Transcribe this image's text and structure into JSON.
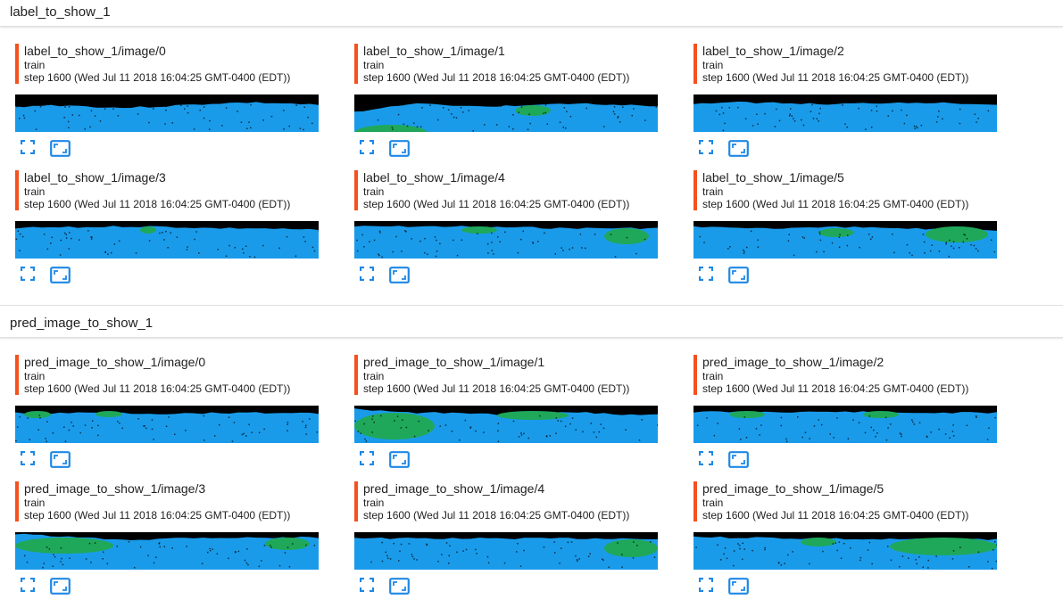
{
  "colors": {
    "accent": "#f4511e",
    "icon": "#1e88e5",
    "sky": "#000000",
    "ground": "#1a9bea",
    "veg": "#1fa85a"
  },
  "sections": [
    {
      "title": "label_to_show_1",
      "cards": [
        {
          "title": "label_to_show_1/image/0",
          "run": "train",
          "step": "step 1600 (Wed Jul 11 2018 16:04:25 GMT-0400 (EDT))"
        },
        {
          "title": "label_to_show_1/image/1",
          "run": "train",
          "step": "step 1600 (Wed Jul 11 2018 16:04:25 GMT-0400 (EDT))"
        },
        {
          "title": "label_to_show_1/image/2",
          "run": "train",
          "step": "step 1600 (Wed Jul 11 2018 16:04:25 GMT-0400 (EDT))"
        },
        {
          "title": "label_to_show_1/image/3",
          "run": "train",
          "step": "step 1600 (Wed Jul 11 2018 16:04:25 GMT-0400 (EDT))"
        },
        {
          "title": "label_to_show_1/image/4",
          "run": "train",
          "step": "step 1600 (Wed Jul 11 2018 16:04:25 GMT-0400 (EDT))"
        },
        {
          "title": "label_to_show_1/image/5",
          "run": "train",
          "step": "step 1600 (Wed Jul 11 2018 16:04:25 GMT-0400 (EDT))"
        }
      ]
    },
    {
      "title": "pred_image_to_show_1",
      "cards": [
        {
          "title": "pred_image_to_show_1/image/0",
          "run": "train",
          "step": "step 1600 (Wed Jul 11 2018 16:04:25 GMT-0400 (EDT))"
        },
        {
          "title": "pred_image_to_show_1/image/1",
          "run": "train",
          "step": "step 1600 (Wed Jul 11 2018 16:04:25 GMT-0400 (EDT))"
        },
        {
          "title": "pred_image_to_show_1/image/2",
          "run": "train",
          "step": "step 1600 (Wed Jul 11 2018 16:04:25 GMT-0400 (EDT))"
        },
        {
          "title": "pred_image_to_show_1/image/3",
          "run": "train",
          "step": "step 1600 (Wed Jul 11 2018 16:04:25 GMT-0400 (EDT))"
        },
        {
          "title": "pred_image_to_show_1/image/4",
          "run": "train",
          "step": "step 1600 (Wed Jul 11 2018 16:04:25 GMT-0400 (EDT))"
        },
        {
          "title": "pred_image_to_show_1/image/5",
          "run": "train",
          "step": "step 1600 (Wed Jul 11 2018 16:04:25 GMT-0400 (EDT))"
        }
      ]
    }
  ],
  "icons": {
    "fullscreen": "fullscreen-icon",
    "actual_size": "actual-size-icon"
  }
}
